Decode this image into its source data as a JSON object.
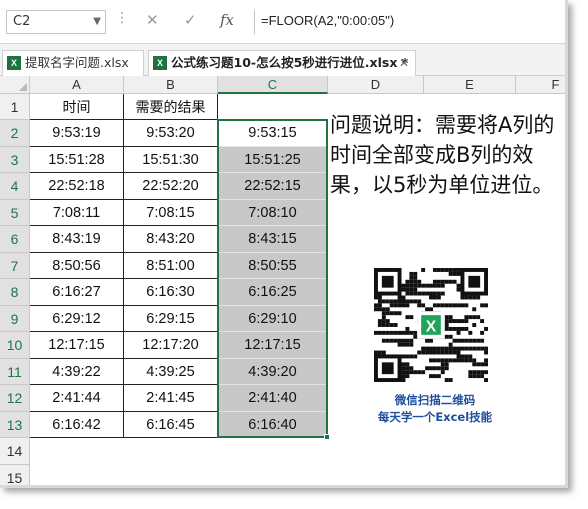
{
  "formula_bar": {
    "name_box": "C2",
    "cancel_icon": "close-icon",
    "enter_icon": "check-icon",
    "fx_label": "fx",
    "formula": "=FLOOR(A2,\"0:00:05\")"
  },
  "tabs": [
    {
      "label": "提取名字问题.xlsx",
      "active": false
    },
    {
      "label": "公式练习题10-怎么按5秒进行进位.xlsx *",
      "active": true
    }
  ],
  "columns": [
    "A",
    "B",
    "C",
    "D",
    "E",
    "F"
  ],
  "rows": [
    "1",
    "2",
    "3",
    "4",
    "5",
    "6",
    "7",
    "8",
    "9",
    "10",
    "11",
    "12",
    "13",
    "14",
    "15"
  ],
  "headers": {
    "a": "时间",
    "b": "需要的结果"
  },
  "table": [
    {
      "a": "9:53:19",
      "b": "9:53:20",
      "c": "9:53:15"
    },
    {
      "a": "15:51:28",
      "b": "15:51:30",
      "c": "15:51:25"
    },
    {
      "a": "22:52:18",
      "b": "22:52:20",
      "c": "22:52:15"
    },
    {
      "a": "7:08:11",
      "b": "7:08:15",
      "c": "7:08:10"
    },
    {
      "a": "8:43:19",
      "b": "8:43:20",
      "c": "8:43:15"
    },
    {
      "a": "8:50:56",
      "b": "8:51:00",
      "c": "8:50:55"
    },
    {
      "a": "6:16:27",
      "b": "6:16:30",
      "c": "6:16:25"
    },
    {
      "a": "6:29:12",
      "b": "6:29:15",
      "c": "6:29:10"
    },
    {
      "a": "12:17:15",
      "b": "12:17:20",
      "c": "12:17:15"
    },
    {
      "a": "4:39:22",
      "b": "4:39:25",
      "c": "4:39:20"
    },
    {
      "a": "2:41:44",
      "b": "2:41:45",
      "c": "2:41:40"
    },
    {
      "a": "6:16:42",
      "b": "6:16:45",
      "c": "6:16:40"
    }
  ],
  "note": "问题说明：需要将A列的时间全部变成B列的效果，以5秒为单位进位。",
  "qr_caption": [
    "微信扫描二维码",
    "每天学一个Excel技能"
  ],
  "colors": {
    "excel_green": "#217346",
    "selection_shade": "#c8c8c8",
    "caption_blue": "#1f4e9b"
  }
}
